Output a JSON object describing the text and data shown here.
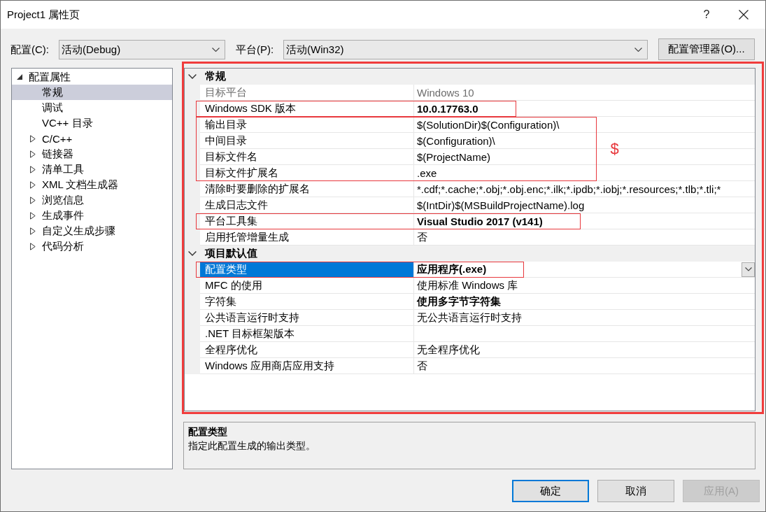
{
  "window": {
    "title": "Project1 属性页",
    "help": "?"
  },
  "toolbar": {
    "configuration": {
      "label": "配置(C):",
      "value": "活动(Debug)"
    },
    "platform": {
      "label": "平台(P):",
      "value": "活动(Win32)"
    },
    "manager_button": "配置管理器(O)..."
  },
  "tree": [
    {
      "label": "配置属性",
      "kind": "group",
      "expanded": true,
      "selected": false,
      "children": [
        {
          "label": "常规",
          "kind": "page",
          "selected": true
        },
        {
          "label": "调试",
          "kind": "page",
          "selected": false
        },
        {
          "label": "VC++ 目录",
          "kind": "page",
          "selected": false
        },
        {
          "label": "C/C++",
          "kind": "group",
          "expanded": false,
          "selected": false
        },
        {
          "label": "链接器",
          "kind": "group",
          "expanded": false,
          "selected": false
        },
        {
          "label": "清单工具",
          "kind": "group",
          "expanded": false,
          "selected": false
        },
        {
          "label": "XML 文档生成器",
          "kind": "group",
          "expanded": false,
          "selected": false
        },
        {
          "label": "浏览信息",
          "kind": "group",
          "expanded": false,
          "selected": false
        },
        {
          "label": "生成事件",
          "kind": "group",
          "expanded": false,
          "selected": false
        },
        {
          "label": "自定义生成步骤",
          "kind": "group",
          "expanded": false,
          "selected": false
        },
        {
          "label": "代码分析",
          "kind": "group",
          "expanded": false,
          "selected": false
        }
      ]
    }
  ],
  "property_grid": {
    "outlined": true,
    "sections": [
      {
        "title": "常规",
        "expanded": true,
        "groups": [
          {
            "outlined": false,
            "rows": [
              {
                "name": "目标平台",
                "value": "Windows 10",
                "disabled": true,
                "modified": false,
                "selected": false
              }
            ]
          },
          {
            "outlined": true,
            "rows": [
              {
                "name": "Windows SDK 版本",
                "value": "10.0.17763.0",
                "disabled": false,
                "modified": true,
                "selected": false
              }
            ]
          },
          {
            "outlined": true,
            "note": "$",
            "rows": [
              {
                "name": "输出目录",
                "value": "$(SolutionDir)$(Configuration)\\",
                "disabled": false,
                "modified": false,
                "selected": false
              },
              {
                "name": "中间目录",
                "value": "$(Configuration)\\",
                "disabled": false,
                "modified": false,
                "selected": false
              },
              {
                "name": "目标文件名",
                "value": "$(ProjectName)",
                "disabled": false,
                "modified": false,
                "selected": false
              },
              {
                "name": "目标文件扩展名",
                "value": ".exe",
                "disabled": false,
                "modified": false,
                "selected": false
              }
            ]
          },
          {
            "outlined": false,
            "rows": [
              {
                "name": "清除时要删除的扩展名",
                "value": "*.cdf;*.cache;*.obj;*.obj.enc;*.ilk;*.ipdb;*.iobj;*.resources;*.tlb;*.tli;*",
                "disabled": false,
                "modified": false,
                "selected": false
              },
              {
                "name": "生成日志文件",
                "value": "$(IntDir)$(MSBuildProjectName).log",
                "disabled": false,
                "modified": false,
                "selected": false
              }
            ]
          },
          {
            "outlined": true,
            "rows": [
              {
                "name": "平台工具集",
                "value": "Visual Studio 2017 (v141)",
                "disabled": false,
                "modified": true,
                "selected": false
              }
            ]
          },
          {
            "outlined": false,
            "rows": [
              {
                "name": "启用托管增量生成",
                "value": "否",
                "disabled": false,
                "modified": false,
                "selected": false
              }
            ]
          }
        ]
      },
      {
        "title": "项目默认值",
        "expanded": true,
        "groups": [
          {
            "outlined": true,
            "rows": [
              {
                "name": "配置类型",
                "value": "应用程序(.exe)",
                "disabled": false,
                "modified": true,
                "selected": true
              }
            ]
          },
          {
            "outlined": false,
            "rows": [
              {
                "name": "MFC 的使用",
                "value": "使用标准 Windows 库",
                "disabled": false,
                "modified": false,
                "selected": false
              },
              {
                "name": "字符集",
                "value": "使用多字节字符集",
                "disabled": false,
                "modified": true,
                "selected": false
              },
              {
                "name": "公共语言运行时支持",
                "value": "无公共语言运行时支持",
                "disabled": false,
                "modified": false,
                "selected": false
              },
              {
                "name": ".NET 目标框架版本",
                "disabled": false,
                "selected": false
              },
              {
                "name": "全程序优化",
                "value": "无全程序优化",
                "disabled": false,
                "modified": false,
                "selected": false
              },
              {
                "name": "Windows 应用商店应用支持",
                "value": "否",
                "disabled": false,
                "modified": false,
                "selected": false
              }
            ]
          }
        ]
      }
    ]
  },
  "description": {
    "title": "配置类型",
    "text": "指定此配置生成的输出类型。"
  },
  "buttons": [
    {
      "label": "确定",
      "default": true,
      "disabled": false
    },
    {
      "label": "取消",
      "default": false,
      "disabled": false
    },
    {
      "label": "应用(A)",
      "default": false,
      "disabled": true
    }
  ]
}
